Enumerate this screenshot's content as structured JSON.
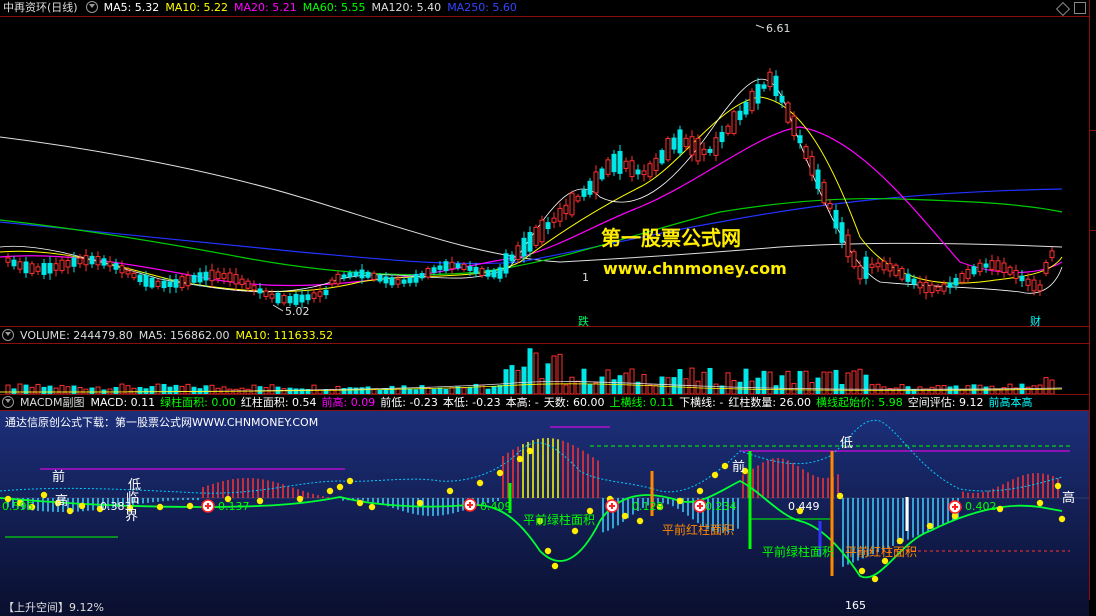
{
  "main_panel": {
    "title": "中再资环(日线)",
    "indicators": [
      {
        "label": "MA5: 5.32",
        "color": "#ffffff"
      },
      {
        "label": "MA10: 5.22",
        "color": "#ffff00"
      },
      {
        "label": "MA20: 5.21",
        "color": "#ff00ff"
      },
      {
        "label": "MA60: 5.55",
        "color": "#00ff00"
      },
      {
        "label": "MA120: 5.40",
        "color": "#dddddd"
      },
      {
        "label": "MA250: 5.60",
        "color": "#3344ff"
      }
    ],
    "high_label": "6.61",
    "low_label": "5.02",
    "watermark_title": "第一股票公式网",
    "watermark_url": "www.chnmoney.com",
    "marker_die": "跌",
    "marker_cai": "财",
    "marker_1": "1"
  },
  "volume_panel": {
    "title": "VOLUME: 244479.80",
    "ma5": "MA5: 156862.00",
    "ma10": "MA10: 111633.52"
  },
  "macd_panel": {
    "title": "MACDM副图",
    "stats": [
      {
        "label": "MACD: 0.11",
        "color": "#ffffff"
      },
      {
        "label": "绿柱面积: 0.00",
        "color": "#00ff00"
      },
      {
        "label": "红柱面积: 0.54",
        "color": "#ffffff"
      },
      {
        "label": "前高: 0.09",
        "color": "#ff00ff"
      },
      {
        "label": "前低: -0.23",
        "color": "#ffffff"
      },
      {
        "label": "本低: -0.23",
        "color": "#ffffff"
      },
      {
        "label": "本高: -",
        "color": "#ffffff"
      },
      {
        "label": "天数: 60.00",
        "color": "#ffffff"
      },
      {
        "label": "上横线: 0.11",
        "color": "#00ff00"
      },
      {
        "label": "下横线: -",
        "color": "#ffffff"
      },
      {
        "label": "红柱数量: 26.00",
        "color": "#ffffff"
      },
      {
        "label": "横线起始价: 5.98",
        "color": "#00ff00"
      },
      {
        "label": "空间评估: 9.12",
        "color": "#ffffff"
      },
      {
        "label": "前高本高",
        "color": "#00ffff"
      }
    ],
    "banner": "通达信原创公式下载：第一股票公式网WWW.CHNMONEY.COM",
    "values": [
      "0.595",
      "0.383",
      "0.137",
      "0.409",
      "0.129",
      "0.234",
      "0.449",
      "0.402",
      "165"
    ],
    "area_labels": [
      "平前绿柱面积",
      "平前红柱面积",
      "平前绿柱面积",
      "平前红柱面积"
    ],
    "words": [
      "前",
      "低",
      "高",
      "临",
      "界",
      "低",
      "前",
      "高"
    ],
    "bottom_label": "【上升空间】9.12%"
  },
  "icons": {
    "menu": "circle-down-icon",
    "diamond": "diamond-icon",
    "window": "window-icon"
  },
  "colors": {
    "up": "#ff3030",
    "down": "#00e5e5",
    "border": "#8a1010",
    "macd_bg_top": "#1a2a6e",
    "macd_bg_bottom": "#0a1030"
  }
}
